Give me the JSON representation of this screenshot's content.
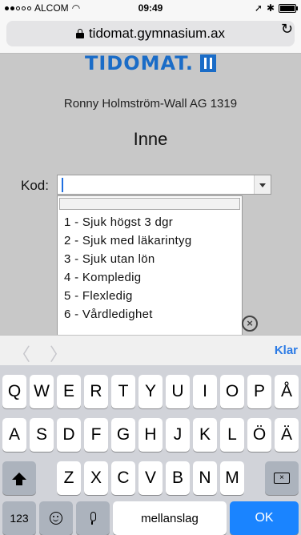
{
  "status_bar": {
    "carrier": "ALCOM",
    "wifi_icon": "wifi-icon",
    "time": "09:49",
    "location_icon": "➚",
    "bluetooth_icon": "✱",
    "battery_level": 0.9
  },
  "browser": {
    "url": "tidomat.gymnasium.ax",
    "reload_icon": "↻"
  },
  "page": {
    "logo_text": "TIDOMAT.",
    "user_name": "Ronny Holmström-Wall AG 1319",
    "status": "Inne",
    "kod_label": "Kod:",
    "kod_value": "",
    "dropdown_options": [
      "1 - Sjuk högst 3 dgr",
      "2 - Sjuk med läkarintyg",
      "3 - Sjuk utan lön",
      "4 - Kompledig",
      "5 - Flexledig",
      "6 - Vårdledighet"
    ],
    "close_symbol": "×"
  },
  "keyboard_accessory": {
    "prev_symbol": "〈",
    "next_symbol": "〉",
    "done_label": "Klar"
  },
  "keyboard": {
    "row1": [
      "Q",
      "W",
      "E",
      "R",
      "T",
      "Y",
      "U",
      "I",
      "O",
      "P",
      "Å"
    ],
    "row2": [
      "A",
      "S",
      "D",
      "F",
      "G",
      "H",
      "J",
      "K",
      "L",
      "Ö",
      "Ä"
    ],
    "row3": [
      "Z",
      "X",
      "C",
      "V",
      "B",
      "N",
      "M"
    ],
    "numbers_label": "123",
    "space_label": "mellanslag",
    "ok_label": "OK"
  },
  "colors": {
    "accent": "#1a84ff",
    "logo": "#1a6cc7",
    "page_background": "#c8c8c8"
  }
}
